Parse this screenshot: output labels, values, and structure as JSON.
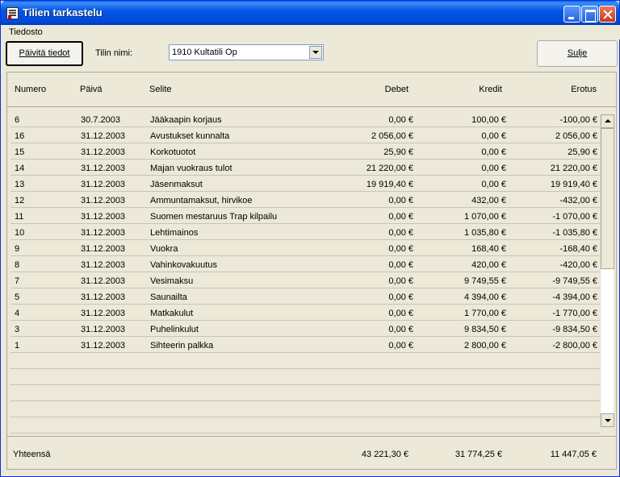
{
  "window": {
    "title": "Tilien tarkastelu"
  },
  "menu": {
    "file": "Tiedosto"
  },
  "toolbar": {
    "refresh_label": "Päivitä tiedot",
    "account_label": "Tilin nimi:",
    "account_value": "1910 Kultatili Op",
    "close_label": "Sulje"
  },
  "table": {
    "headers": {
      "number": "Numero",
      "date": "Päivä",
      "description": "Selite",
      "debet": "Debet",
      "kredit": "Kredit",
      "difference": "Erotus"
    },
    "rows": [
      {
        "number": "6",
        "date": "30.7.2003",
        "description": "Jääkaapin korjaus",
        "debet": "0,00 €",
        "kredit": "100,00 €",
        "difference": "-100,00 €"
      },
      {
        "number": "16",
        "date": "31.12.2003",
        "description": "Avustukset kunnalta",
        "debet": "2 056,00 €",
        "kredit": "0,00 €",
        "difference": "2 056,00 €"
      },
      {
        "number": "15",
        "date": "31.12.2003",
        "description": "Korkotuotot",
        "debet": "25,90 €",
        "kredit": "0,00 €",
        "difference": "25,90 €"
      },
      {
        "number": "14",
        "date": "31.12.2003",
        "description": "Majan vuokraus tulot",
        "debet": "21 220,00 €",
        "kredit": "0,00 €",
        "difference": "21 220,00 €"
      },
      {
        "number": "13",
        "date": "31.12.2003",
        "description": "Jäsenmaksut",
        "debet": "19 919,40 €",
        "kredit": "0,00 €",
        "difference": "19 919,40 €"
      },
      {
        "number": "12",
        "date": "31.12.2003",
        "description": "Ammuntamaksut, hirvikoe",
        "debet": "0,00 €",
        "kredit": "432,00 €",
        "difference": "-432,00 €"
      },
      {
        "number": "11",
        "date": "31.12.2003",
        "description": "Suomen mestaruus Trap kilpailu",
        "debet": "0,00 €",
        "kredit": "1 070,00 €",
        "difference": "-1 070,00 €"
      },
      {
        "number": "10",
        "date": "31.12.2003",
        "description": "Lehtimainos",
        "debet": "0,00 €",
        "kredit": "1 035,80 €",
        "difference": "-1 035,80 €"
      },
      {
        "number": "9",
        "date": "31.12.2003",
        "description": "Vuokra",
        "debet": "0,00 €",
        "kredit": "168,40 €",
        "difference": "-168,40 €"
      },
      {
        "number": "8",
        "date": "31.12.2003",
        "description": "Vahinkovakuutus",
        "debet": "0,00 €",
        "kredit": "420,00 €",
        "difference": "-420,00 €"
      },
      {
        "number": "7",
        "date": "31.12.2003",
        "description": "Vesimaksu",
        "debet": "0,00 €",
        "kredit": "9 749,55 €",
        "difference": "-9 749,55 €"
      },
      {
        "number": "5",
        "date": "31.12.2003",
        "description": "Saunailta",
        "debet": "0,00 €",
        "kredit": "4 394,00 €",
        "difference": "-4 394,00 €"
      },
      {
        "number": "4",
        "date": "31.12.2003",
        "description": "Matkakulut",
        "debet": "0,00 €",
        "kredit": "1 770,00 €",
        "difference": "-1 770,00 €"
      },
      {
        "number": "3",
        "date": "31.12.2003",
        "description": "Puhelinkulut",
        "debet": "0,00 €",
        "kredit": "9 834,50 €",
        "difference": "-9 834,50 €"
      },
      {
        "number": "1",
        "date": "31.12.2003",
        "description": "Sihteerin palkka",
        "debet": "0,00 €",
        "kredit": "2 800,00 €",
        "difference": "-2 800,00 €"
      }
    ],
    "empty_row_count": 5
  },
  "totals": {
    "label": "Yhteensä",
    "debet": "43 221,30 €",
    "kredit": "31 774,25 €",
    "difference": "11 447,05 €"
  },
  "colors": {
    "titlebar": "#0054e3",
    "face": "#ece9d8",
    "close_button": "#c43d1a"
  },
  "icons": [
    "app-window-icon",
    "minimize-icon",
    "maximize-icon",
    "close-icon",
    "dropdown-arrow-icon",
    "scroll-up-icon",
    "scroll-down-icon"
  ]
}
